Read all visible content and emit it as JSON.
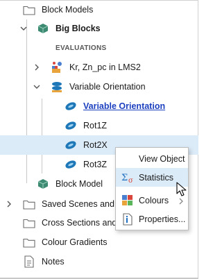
{
  "tree": {
    "block_models": "Block Models",
    "big_blocks": "Big Blocks",
    "evaluations_header": "EVALUATIONS",
    "kr_item": "Kr, Zn_pc in LMS2",
    "variable_orientation": "Variable Orientation",
    "variable_orientation_link": "Variable Orientation",
    "rot1z": "Rot1Z",
    "rot2x": "Rot2X",
    "rot3z": "Rot3Z",
    "block_model": "Block Model",
    "saved_scenes": "Saved Scenes and M",
    "cross_sections": "Cross Sections and",
    "colour_gradients": "Colour Gradients",
    "notes": "Notes"
  },
  "context_menu": {
    "view_object": "View Object",
    "statistics": "Statistics",
    "colours": "Colours",
    "properties": "Properties..."
  },
  "colors": {
    "selection": "#dcebf8",
    "link": "#1a3fbf",
    "ellipsoid": "#1e78b8",
    "block_green": "#3c8a72"
  }
}
